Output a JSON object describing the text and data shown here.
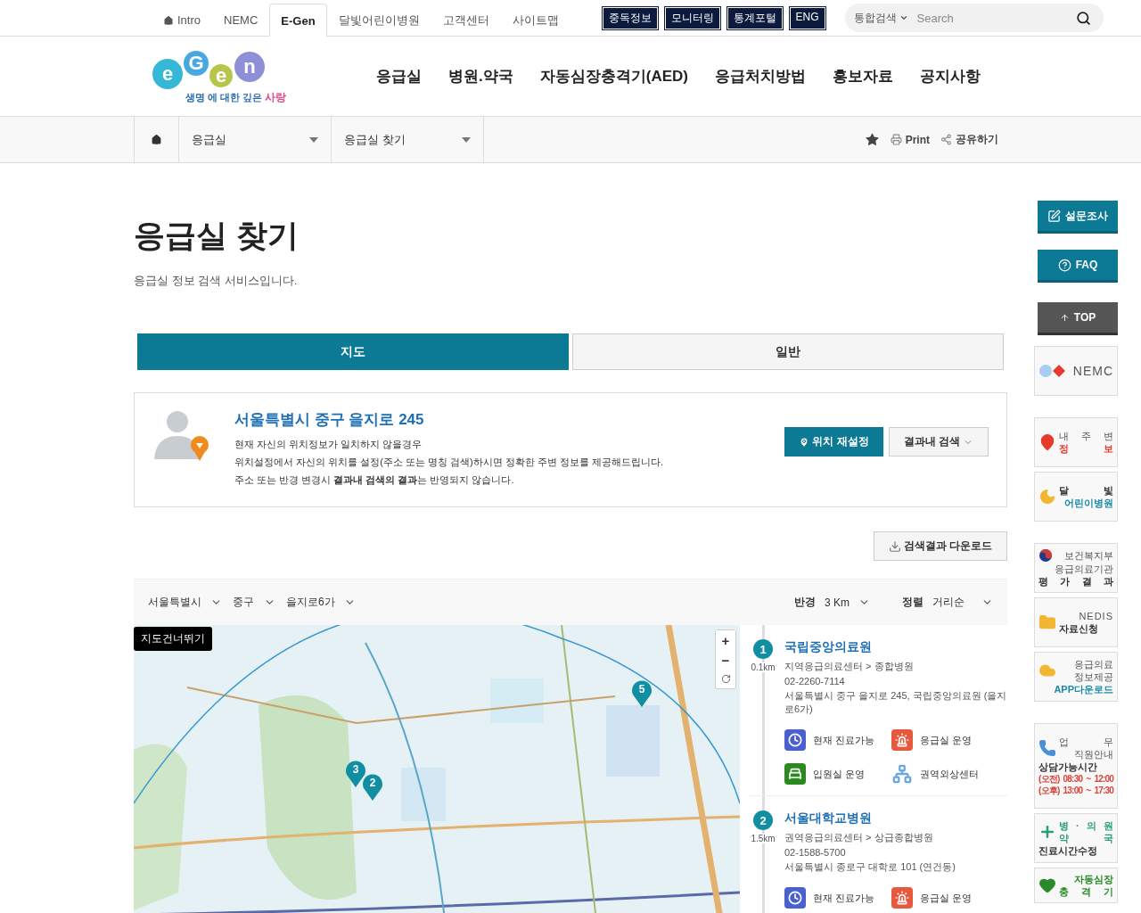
{
  "topbar": {
    "links": [
      {
        "label": "Intro",
        "kind": "home",
        "selected": false
      },
      {
        "label": "NEMC",
        "kind": "plain",
        "selected": false
      },
      {
        "label": "E-Gen",
        "kind": "plain",
        "selected": true
      },
      {
        "label": "달빛어린이병원",
        "kind": "plain",
        "selected": false
      },
      {
        "label": "고객센터",
        "kind": "plain",
        "selected": false
      },
      {
        "label": "사이트맵",
        "kind": "plain",
        "selected": false
      }
    ],
    "badges": [
      "중독정보",
      "모니터링",
      "통계포털",
      "ENG"
    ],
    "search": {
      "scope": "통합검색",
      "placeholder": "Search"
    }
  },
  "logo": {
    "letters": [
      "e",
      "G",
      "e",
      "n"
    ],
    "tagline_a": "생명",
    "tagline_b": "에 대한 깊은",
    "tagline_c": "사랑"
  },
  "menu": [
    "응급실",
    "병원.약국",
    "자동심장충격기(AED)",
    "응급처치방법",
    "홍보자료",
    "공지사항"
  ],
  "breadcrumb": {
    "items": [
      "응급실",
      "응급실 찾기"
    ],
    "tools": [
      {
        "kind": "print",
        "label": "Print"
      },
      {
        "kind": "share",
        "label": "공유하기"
      }
    ]
  },
  "page": {
    "title": "응급실 찾기",
    "subtitle": "응급실 정보 검색 서비스입니다."
  },
  "tabs": [
    {
      "label": "지도",
      "selected": true
    },
    {
      "label": "일반",
      "selected": false
    }
  ],
  "location": {
    "address": "서울특별시 중구 을지로 245",
    "notes": [
      "현재 자신의 위치정보가 일치하지 않을경우",
      "위치설정에서 자신의 위치를 설정(주소 또는 명칭 검색)하시면 정확한 주변 정보를 제공해드립니다.",
      "주소 또는 반경 변경시 **결과내 검색의 결과**는 반영되지 않습니다."
    ],
    "reset_button": "위치 재설정",
    "search_button": "결과내 검색"
  },
  "download_button": "검색결과 다운로드",
  "filters": {
    "regions": [
      "서울특별시",
      "중구",
      "을지로6가"
    ],
    "radius_label": "반경",
    "radius": "3 Km",
    "sort_label": "정렬",
    "sort": "거리순"
  },
  "map": {
    "skip_link": "지도건너뛰기",
    "zoom_in": "+",
    "zoom_out": "−",
    "markers": [
      "3",
      "2",
      "5"
    ]
  },
  "results": [
    {
      "rank": "1",
      "distance": "0.1km",
      "name": "국립중앙의료원",
      "category": "지역응급의료센터 > 종합병원",
      "phone": "02-2260-7114",
      "address": "서울특별시 중구 을지로 245, 국립중앙의료원 (을지로6가)",
      "services": [
        {
          "kind": "clock",
          "label": "현재 진료가능"
        },
        {
          "kind": "siren",
          "label": "응급실 운영"
        },
        {
          "kind": "bed",
          "label": "입원실 운영"
        },
        {
          "kind": "network",
          "label": "권역외상센터"
        }
      ]
    },
    {
      "rank": "2",
      "distance": "1.5km",
      "name": "서울대학교병원",
      "category": "권역응급의료센터 > 상급종합병원",
      "phone": "02-1588-5700",
      "address": "서울특별시 종로구 대학로 101 (연건동)",
      "services": [
        {
          "kind": "clock",
          "label": "현재 진료가능"
        },
        {
          "kind": "siren",
          "label": "응급실 운영"
        }
      ]
    }
  ],
  "quick": [
    {
      "kind": "survey",
      "label": "설문조사"
    },
    {
      "kind": "faq",
      "label": "FAQ"
    },
    {
      "kind": "top",
      "label": "TOP"
    }
  ],
  "banners": [
    {
      "kind": "nemc",
      "color": "#e53b2c",
      "head": [
        {
          "text": "NEMC",
          "kind": "logo"
        }
      ]
    },
    {
      "kind": "pin",
      "color": "#e53b2c",
      "head": [
        {
          "text": "내 주 변",
          "kind": "plain"
        },
        {
          "text": "정 보",
          "kind": "accent"
        }
      ]
    },
    {
      "kind": "moon",
      "color": "#1a8aa8",
      "head": [
        {
          "text": "달 빛",
          "kind": "bold"
        },
        {
          "text": "어린이병원",
          "kind": "accent"
        }
      ]
    },
    {
      "kind": "flag",
      "head": [
        {
          "text": "보건복지부",
          "kind": "plain"
        }
      ],
      "lines": [
        {
          "text": "응급의료기관",
          "kind": "plain"
        },
        {
          "text": "평 가 결 과",
          "kind": "bold"
        }
      ]
    },
    {
      "kind": "folder",
      "head": [
        {
          "text": "NEDIS",
          "kind": "plain"
        },
        {
          "text": "자료신청",
          "kind": "bold"
        }
      ]
    },
    {
      "kind": "cloud",
      "color": "#1a8aa8",
      "head": [
        {
          "text": "응급의료",
          "kind": "plain"
        },
        {
          "text": "정보제공",
          "kind": "plain"
        }
      ],
      "lines": [
        {
          "text": "APP다운로드",
          "kind": "accent"
        }
      ]
    },
    {
      "kind": "phone",
      "color": "#d9443a",
      "head": [
        {
          "text": "업 무",
          "kind": "plain"
        },
        {
          "text": "직원안내",
          "kind": "plain"
        }
      ],
      "lines": [
        {
          "text": "상담가능시간",
          "kind": "bold"
        },
        {
          "text": "(오전) 08:30 ~ 12:00",
          "kind": "note"
        },
        {
          "text": "(오후) 13:00 ~ 17:30",
          "kind": "note"
        }
      ]
    },
    {
      "kind": "cross",
      "color": "#2a9d7a",
      "head": [
        {
          "text": "병 · 의 원",
          "kind": "accent"
        },
        {
          "text": "약 국",
          "kind": "accent"
        }
      ],
      "lines": [
        {
          "text": "진료시간수정",
          "kind": "bold"
        }
      ]
    },
    {
      "kind": "heart",
      "color": "#2a8a2a",
      "head": [
        {
          "text": "자동심장",
          "kind": "accent"
        },
        {
          "text": "충 격 기",
          "kind": "accent"
        }
      ]
    }
  ]
}
